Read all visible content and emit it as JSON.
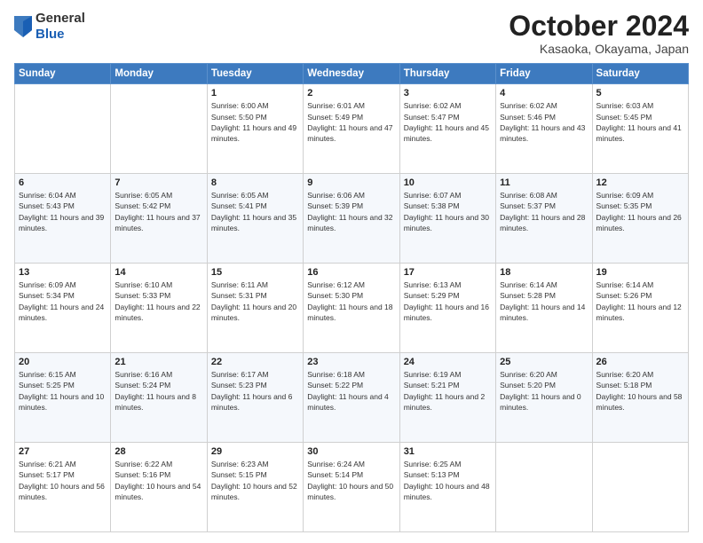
{
  "logo": {
    "general": "General",
    "blue": "Blue"
  },
  "header": {
    "month": "October 2024",
    "location": "Kasaoka, Okayama, Japan"
  },
  "weekdays": [
    "Sunday",
    "Monday",
    "Tuesday",
    "Wednesday",
    "Thursday",
    "Friday",
    "Saturday"
  ],
  "weeks": [
    [
      {
        "day": "",
        "info": ""
      },
      {
        "day": "",
        "info": ""
      },
      {
        "day": "1",
        "info": "Sunrise: 6:00 AM\nSunset: 5:50 PM\nDaylight: 11 hours and 49 minutes."
      },
      {
        "day": "2",
        "info": "Sunrise: 6:01 AM\nSunset: 5:49 PM\nDaylight: 11 hours and 47 minutes."
      },
      {
        "day": "3",
        "info": "Sunrise: 6:02 AM\nSunset: 5:47 PM\nDaylight: 11 hours and 45 minutes."
      },
      {
        "day": "4",
        "info": "Sunrise: 6:02 AM\nSunset: 5:46 PM\nDaylight: 11 hours and 43 minutes."
      },
      {
        "day": "5",
        "info": "Sunrise: 6:03 AM\nSunset: 5:45 PM\nDaylight: 11 hours and 41 minutes."
      }
    ],
    [
      {
        "day": "6",
        "info": "Sunrise: 6:04 AM\nSunset: 5:43 PM\nDaylight: 11 hours and 39 minutes."
      },
      {
        "day": "7",
        "info": "Sunrise: 6:05 AM\nSunset: 5:42 PM\nDaylight: 11 hours and 37 minutes."
      },
      {
        "day": "8",
        "info": "Sunrise: 6:05 AM\nSunset: 5:41 PM\nDaylight: 11 hours and 35 minutes."
      },
      {
        "day": "9",
        "info": "Sunrise: 6:06 AM\nSunset: 5:39 PM\nDaylight: 11 hours and 32 minutes."
      },
      {
        "day": "10",
        "info": "Sunrise: 6:07 AM\nSunset: 5:38 PM\nDaylight: 11 hours and 30 minutes."
      },
      {
        "day": "11",
        "info": "Sunrise: 6:08 AM\nSunset: 5:37 PM\nDaylight: 11 hours and 28 minutes."
      },
      {
        "day": "12",
        "info": "Sunrise: 6:09 AM\nSunset: 5:35 PM\nDaylight: 11 hours and 26 minutes."
      }
    ],
    [
      {
        "day": "13",
        "info": "Sunrise: 6:09 AM\nSunset: 5:34 PM\nDaylight: 11 hours and 24 minutes."
      },
      {
        "day": "14",
        "info": "Sunrise: 6:10 AM\nSunset: 5:33 PM\nDaylight: 11 hours and 22 minutes."
      },
      {
        "day": "15",
        "info": "Sunrise: 6:11 AM\nSunset: 5:31 PM\nDaylight: 11 hours and 20 minutes."
      },
      {
        "day": "16",
        "info": "Sunrise: 6:12 AM\nSunset: 5:30 PM\nDaylight: 11 hours and 18 minutes."
      },
      {
        "day": "17",
        "info": "Sunrise: 6:13 AM\nSunset: 5:29 PM\nDaylight: 11 hours and 16 minutes."
      },
      {
        "day": "18",
        "info": "Sunrise: 6:14 AM\nSunset: 5:28 PM\nDaylight: 11 hours and 14 minutes."
      },
      {
        "day": "19",
        "info": "Sunrise: 6:14 AM\nSunset: 5:26 PM\nDaylight: 11 hours and 12 minutes."
      }
    ],
    [
      {
        "day": "20",
        "info": "Sunrise: 6:15 AM\nSunset: 5:25 PM\nDaylight: 11 hours and 10 minutes."
      },
      {
        "day": "21",
        "info": "Sunrise: 6:16 AM\nSunset: 5:24 PM\nDaylight: 11 hours and 8 minutes."
      },
      {
        "day": "22",
        "info": "Sunrise: 6:17 AM\nSunset: 5:23 PM\nDaylight: 11 hours and 6 minutes."
      },
      {
        "day": "23",
        "info": "Sunrise: 6:18 AM\nSunset: 5:22 PM\nDaylight: 11 hours and 4 minutes."
      },
      {
        "day": "24",
        "info": "Sunrise: 6:19 AM\nSunset: 5:21 PM\nDaylight: 11 hours and 2 minutes."
      },
      {
        "day": "25",
        "info": "Sunrise: 6:20 AM\nSunset: 5:20 PM\nDaylight: 11 hours and 0 minutes."
      },
      {
        "day": "26",
        "info": "Sunrise: 6:20 AM\nSunset: 5:18 PM\nDaylight: 10 hours and 58 minutes."
      }
    ],
    [
      {
        "day": "27",
        "info": "Sunrise: 6:21 AM\nSunset: 5:17 PM\nDaylight: 10 hours and 56 minutes."
      },
      {
        "day": "28",
        "info": "Sunrise: 6:22 AM\nSunset: 5:16 PM\nDaylight: 10 hours and 54 minutes."
      },
      {
        "day": "29",
        "info": "Sunrise: 6:23 AM\nSunset: 5:15 PM\nDaylight: 10 hours and 52 minutes."
      },
      {
        "day": "30",
        "info": "Sunrise: 6:24 AM\nSunset: 5:14 PM\nDaylight: 10 hours and 50 minutes."
      },
      {
        "day": "31",
        "info": "Sunrise: 6:25 AM\nSunset: 5:13 PM\nDaylight: 10 hours and 48 minutes."
      },
      {
        "day": "",
        "info": ""
      },
      {
        "day": "",
        "info": ""
      }
    ]
  ]
}
